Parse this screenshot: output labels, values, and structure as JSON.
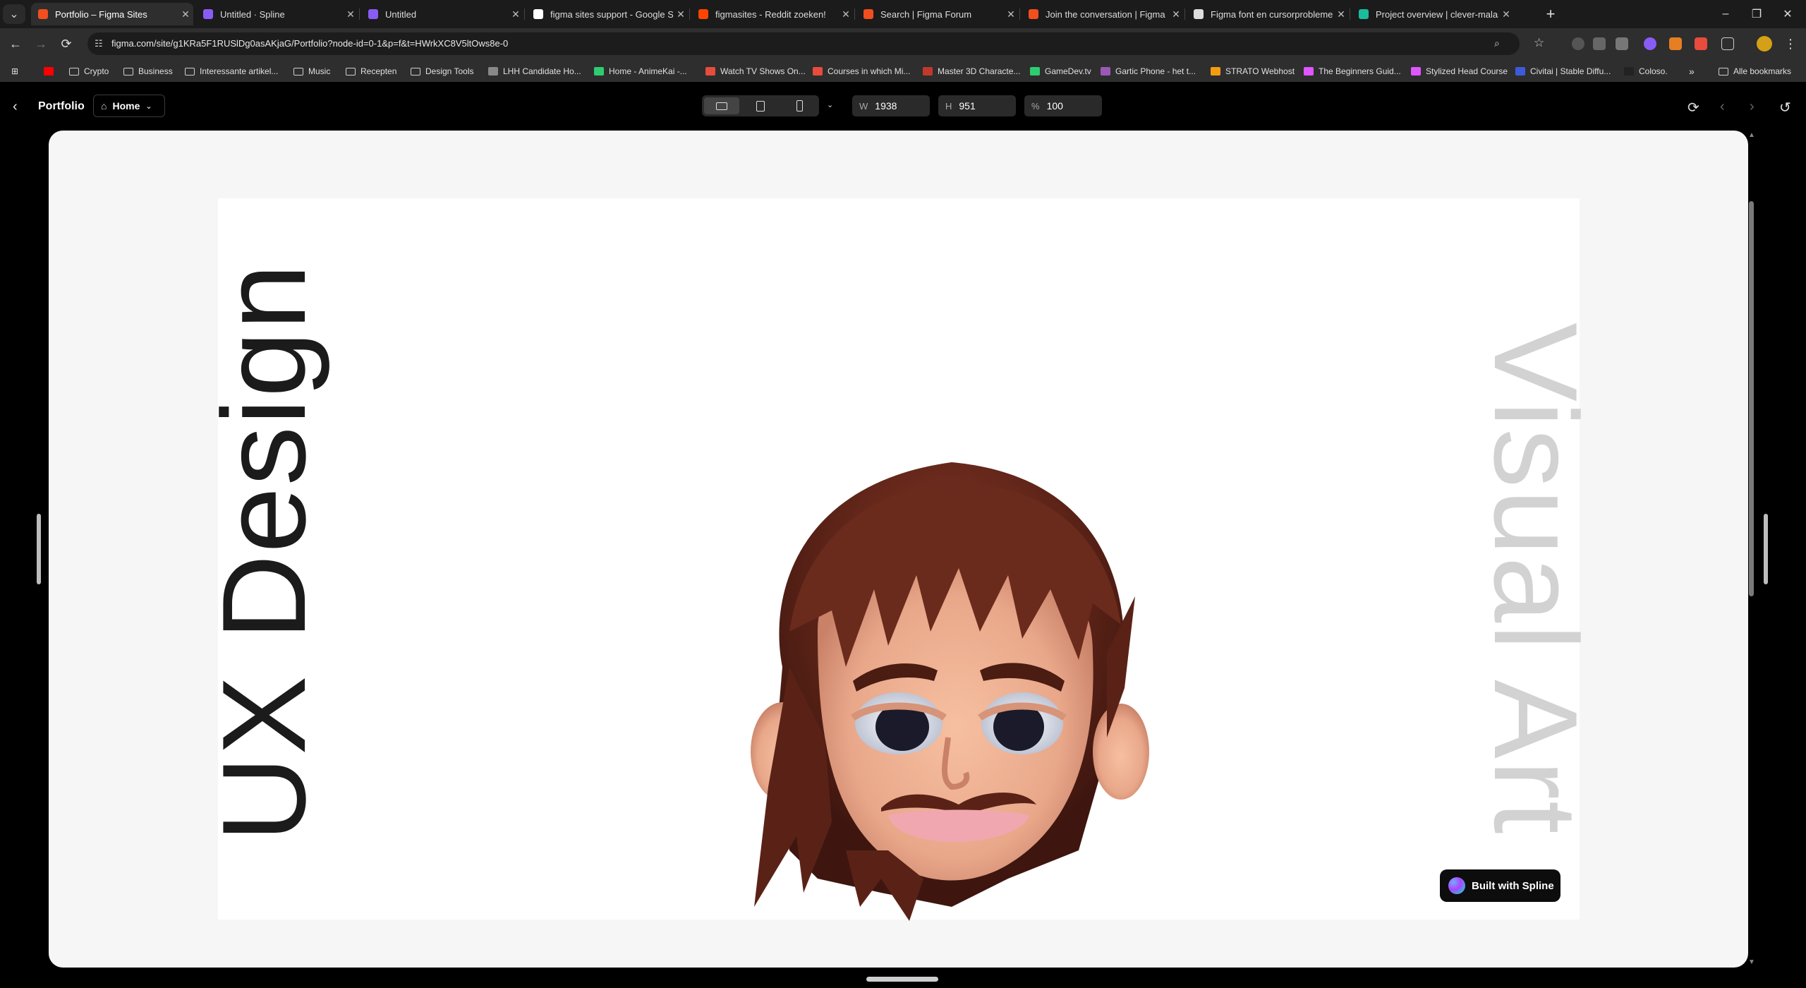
{
  "browser": {
    "tabs": [
      {
        "title": "Portfolio – Figma Sites",
        "fav_color": "#f24e1e",
        "active": true
      },
      {
        "title": "Untitled · Spline",
        "fav_color": "#8a5cf6",
        "active": false
      },
      {
        "title": "Untitled",
        "fav_color": "#8a5cf6",
        "active": false
      },
      {
        "title": "figma sites support - Google Se",
        "fav_color": "#ffffff",
        "active": false
      },
      {
        "title": "figmasites - Reddit zoeken!",
        "fav_color": "#ff4500",
        "active": false
      },
      {
        "title": "Search | Figma Forum",
        "fav_color": "#f24e1e",
        "active": false
      },
      {
        "title": "Join the conversation | Figma F",
        "fav_color": "#f24e1e",
        "active": false
      },
      {
        "title": "Figma font en cursorproblemen",
        "fav_color": "#dddddd",
        "active": false
      },
      {
        "title": "Project overview | clever-malas",
        "fav_color": "#1abc9c",
        "active": false
      }
    ],
    "tab_close": "✕",
    "new_tab": "+",
    "url": "figma.com/site/g1KRa5F1RUSlDg0asAKjaG/Portfolio?node-id=0-1&p=f&t=HWrkXC8V5ltOws8e-0",
    "bookmarks": [
      {
        "label": "",
        "type": "icon",
        "color": "#ff0000"
      },
      {
        "label": "Crypto",
        "type": "folder"
      },
      {
        "label": "Business",
        "type": "folder"
      },
      {
        "label": "Interessante artikel...",
        "type": "folder"
      },
      {
        "label": "Music",
        "type": "folder"
      },
      {
        "label": "Recepten",
        "type": "folder"
      },
      {
        "label": "Design Tools",
        "type": "folder"
      },
      {
        "label": "LHH Candidate Ho...",
        "type": "icon",
        "color": "#888888"
      },
      {
        "label": "Home - AnimeKai -...",
        "type": "icon",
        "color": "#2ecc71"
      },
      {
        "label": "Watch TV Shows On...",
        "type": "icon",
        "color": "#e74c3c"
      },
      {
        "label": "Courses in which Mi...",
        "type": "icon",
        "color": "#e74c3c"
      },
      {
        "label": "Master 3D Characte...",
        "type": "icon",
        "color": "#c0392b"
      },
      {
        "label": "GameDev.tv",
        "type": "icon",
        "color": "#2ecc71"
      },
      {
        "label": "Gartic Phone - het t...",
        "type": "icon",
        "color": "#9b59b6"
      },
      {
        "label": "STRATO Webhost",
        "type": "icon",
        "color": "#f39c12"
      },
      {
        "label": "The Beginners Guid...",
        "type": "icon",
        "color": "#e056fd"
      },
      {
        "label": "Stylized Head Course",
        "type": "icon",
        "color": "#e056fd"
      },
      {
        "label": "Civitai | Stable Diffu...",
        "type": "icon",
        "color": "#3b5bdb"
      },
      {
        "label": "Coloso.",
        "type": "icon",
        "color": "#222222"
      }
    ],
    "bookmarks_overflow": "»",
    "all_bookmarks": "Alle bookmarks"
  },
  "figma": {
    "project_title": "Portfolio",
    "page_selector": "Home",
    "width_label": "W",
    "width_value": "1938",
    "height_label": "H",
    "height_value": "951",
    "zoom_label": "%",
    "zoom_value": "100"
  },
  "site": {
    "left_text": "UX Design",
    "right_text": "Visual Art",
    "badge": "Built with Spline"
  }
}
